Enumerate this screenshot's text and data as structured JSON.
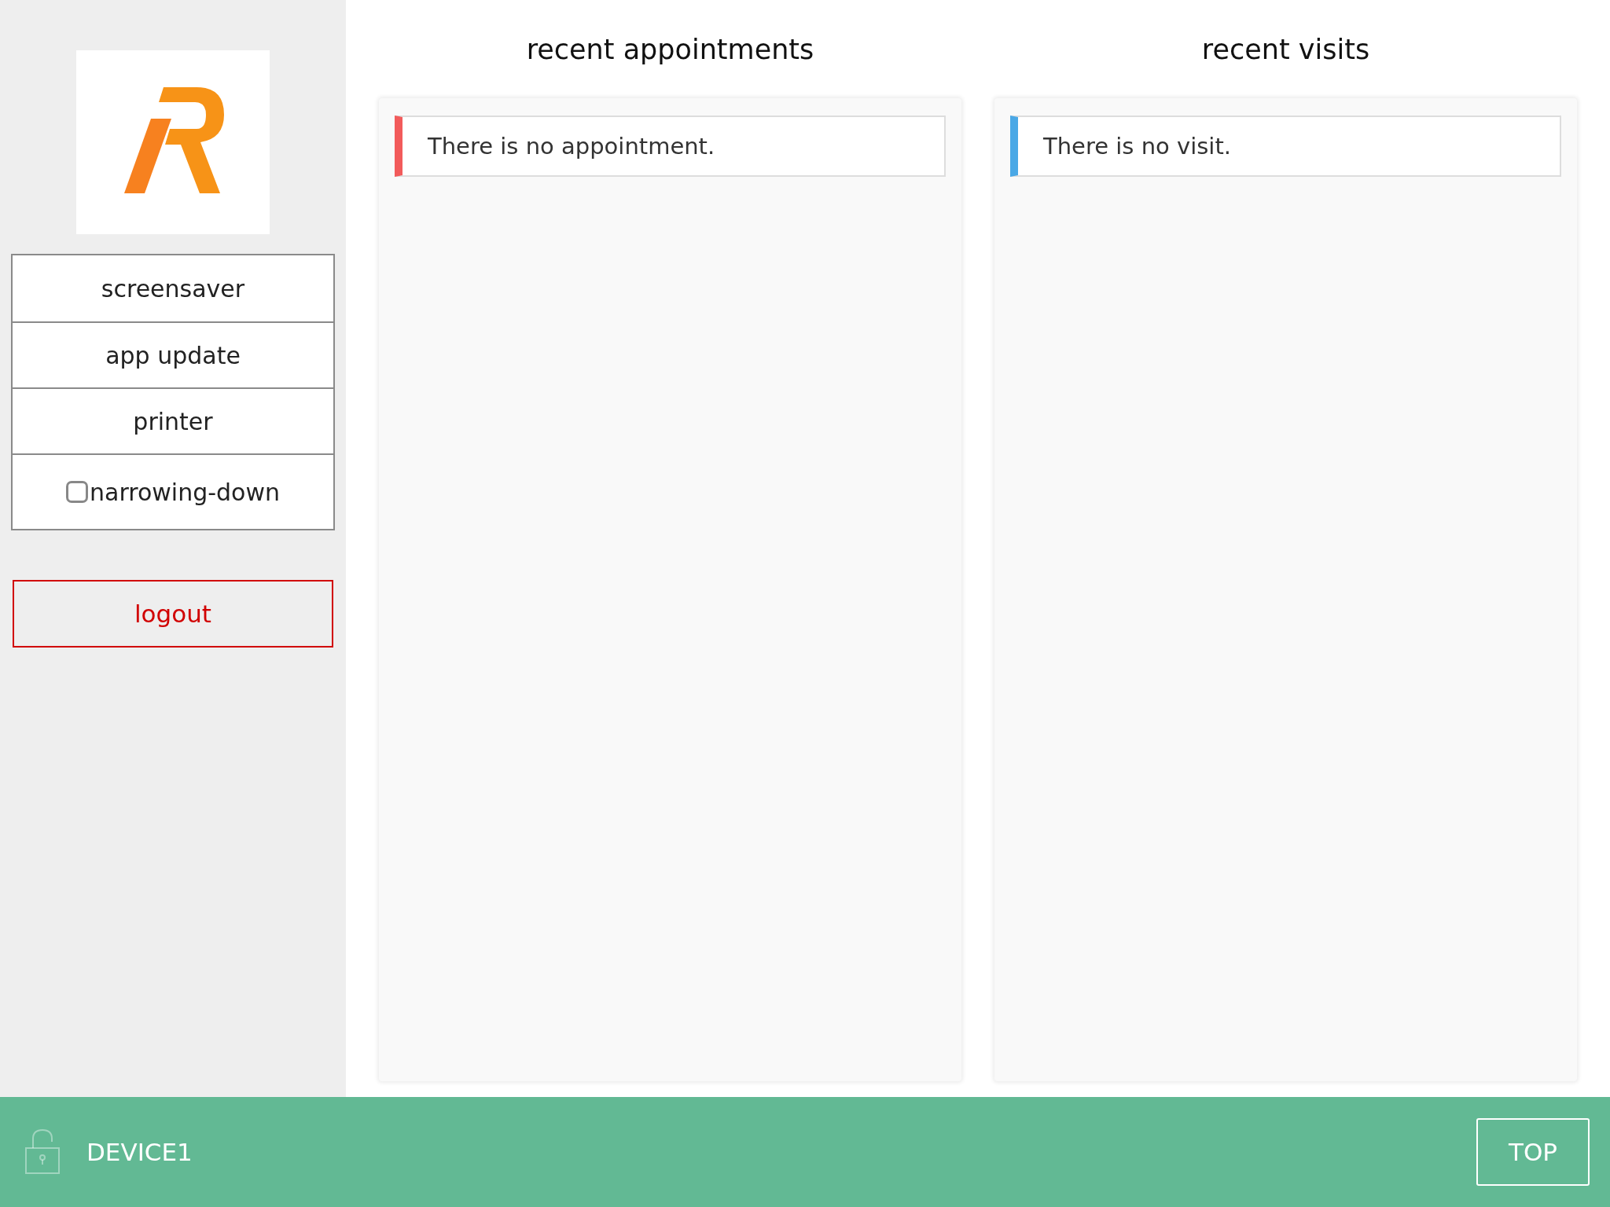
{
  "sidebar": {
    "menu": [
      {
        "kind": "button",
        "label": "screensaver"
      },
      {
        "kind": "button",
        "label": "app update"
      },
      {
        "kind": "button",
        "label": "printer"
      },
      {
        "kind": "checkbox",
        "label": "narrowing-down",
        "checked": false
      }
    ],
    "logout": "logout"
  },
  "panels": [
    {
      "title": "recent appointments",
      "message": "There is no appointment.",
      "color": "#f25b5b"
    },
    {
      "title": "recent visits",
      "message": "There is no visit.",
      "color": "#4aa8e6"
    }
  ],
  "footer": {
    "device": "DEVICE1",
    "locked": false,
    "top_button": "TOP"
  }
}
